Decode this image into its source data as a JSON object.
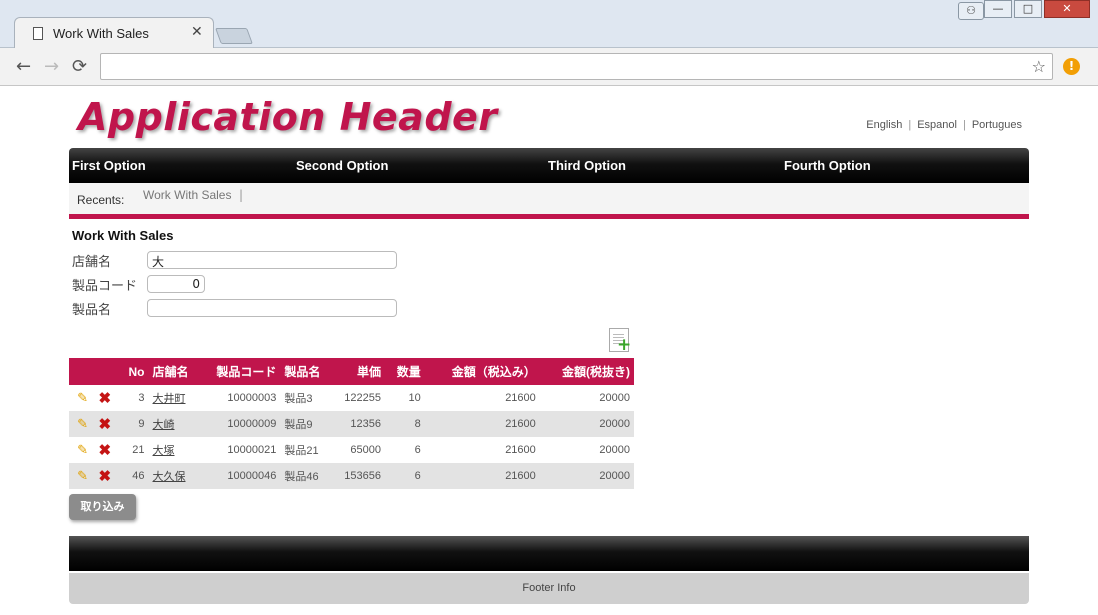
{
  "browser": {
    "tab_title": "Work With Sales",
    "tab_close": "✕",
    "address_value": "",
    "back": "←",
    "forward": "→",
    "reload": "⟳",
    "star": "☆",
    "alert": "!"
  },
  "window": {
    "minimize": "—",
    "maximize": "□",
    "close": "✕",
    "user": "👤"
  },
  "app": {
    "header": "Application Header",
    "languages": [
      "English",
      "Espanol",
      "Portugues"
    ]
  },
  "menu": [
    "First Option",
    "Second Option",
    "Third Option",
    "Fourth Option"
  ],
  "recents": {
    "label": "Recents:",
    "items": [
      "Work With Sales"
    ],
    "separator": "|"
  },
  "form": {
    "title": "Work With Sales",
    "fields": [
      {
        "label": "店舗名",
        "value": ""
      },
      {
        "label": "製品コード",
        "value": "0"
      },
      {
        "label": "製品名",
        "value": ""
      }
    ],
    "store_value": "大"
  },
  "grid": {
    "headers": [
      "",
      "",
      "No",
      "店舗名",
      "製品コード",
      "製品名",
      "単価",
      "数量",
      "金額（税込み）",
      "金額(税抜き)"
    ],
    "rows": [
      {
        "no": "3",
        "store": "大井町",
        "code": "10000003",
        "product": "製品3",
        "price": "122255",
        "qty": "10",
        "amt_incl": "21600",
        "amt_excl": "20000"
      },
      {
        "no": "9",
        "store": "大崎",
        "code": "10000009",
        "product": "製品9",
        "price": "12356",
        "qty": "8",
        "amt_incl": "21600",
        "amt_excl": "20000"
      },
      {
        "no": "21",
        "store": "大塚",
        "code": "10000021",
        "product": "製品21",
        "price": "65000",
        "qty": "6",
        "amt_incl": "21600",
        "amt_excl": "20000"
      },
      {
        "no": "46",
        "store": "大久保",
        "code": "10000046",
        "product": "製品46",
        "price": "153656",
        "qty": "6",
        "amt_incl": "21600",
        "amt_excl": "20000"
      }
    ]
  },
  "buttons": {
    "import": "取り込み"
  },
  "footer": {
    "info": "Footer Info"
  },
  "colors": {
    "accent": "#c0154c",
    "header_gradient_dark": "#000000",
    "row_alt": "#e3e3e3"
  }
}
